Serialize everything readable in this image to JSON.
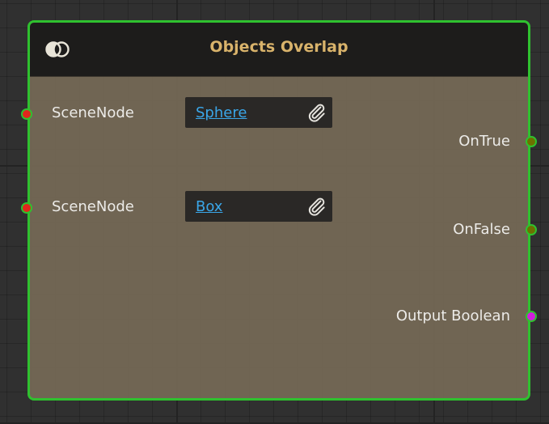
{
  "node": {
    "title": "Objects Overlap",
    "icon": "overlap-circles-icon"
  },
  "inputs": [
    {
      "label": "SceneNode",
      "value": "Sphere",
      "port_color": "#e1261c"
    },
    {
      "label": "SceneNode",
      "value": "Box",
      "port_color": "#e1261c"
    }
  ],
  "outputs": [
    {
      "label": "OnTrue",
      "port_color": "#6e7000"
    },
    {
      "label": "OnFalse",
      "port_color": "#6e7000"
    },
    {
      "label": "Output Boolean",
      "port_color": "#d21fdc"
    }
  ],
  "colors": {
    "node_border": "#2fc12f",
    "title": "#d9b36b",
    "link": "#3aa6e8",
    "header_bg": "#1d1c1b",
    "body_bg": "#786c58"
  }
}
